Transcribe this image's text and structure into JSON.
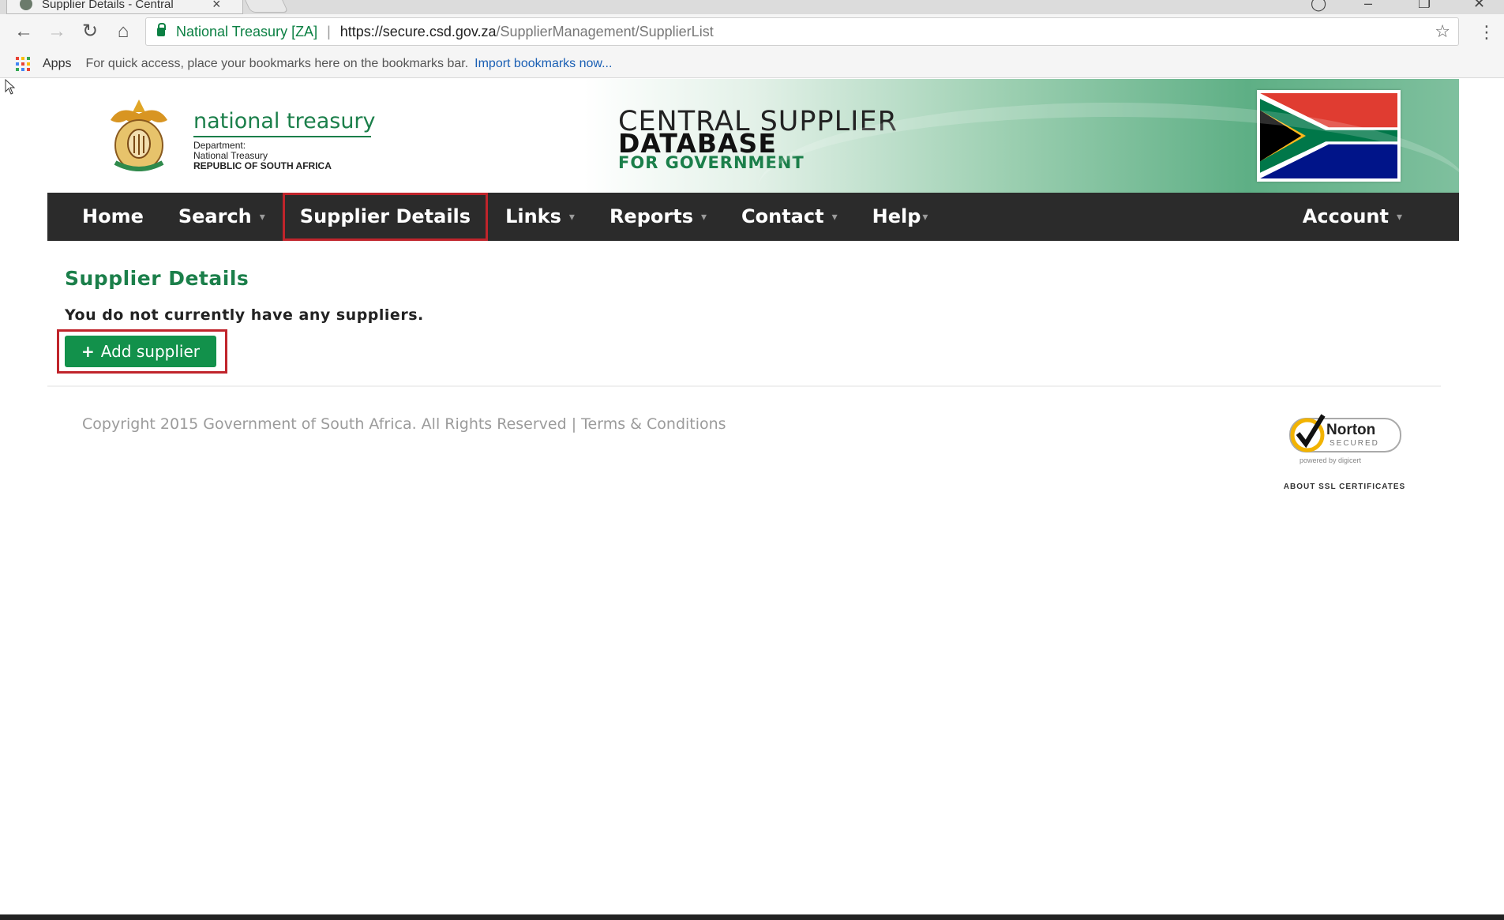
{
  "browser": {
    "tab_title": "Supplier Details - Central",
    "tab_close": "×",
    "secure_label": "National Treasury [ZA]",
    "url_host": "https://secure.csd.gov.za",
    "url_path": "/SupplierManagement/SupplierList",
    "bookmarks": {
      "apps_label": "Apps",
      "hint": "For quick access, place your bookmarks here on the bookmarks bar.",
      "import_link": "Import bookmarks now..."
    }
  },
  "header": {
    "org_name": "national treasury",
    "dept_line1": "Department:",
    "dept_line2": "National Treasury",
    "dept_line3": "REPUBLIC OF SOUTH AFRICA",
    "csd_line1": "CENTRAL SUPPLIER",
    "csd_line2": "DATABASE",
    "csd_line3": "FOR GOVERNMENT"
  },
  "nav": {
    "home": "Home",
    "search": "Search",
    "supplier_details": "Supplier Details",
    "links": "Links",
    "reports": "Reports",
    "contact": "Contact",
    "help": "Help",
    "account": "Account",
    "active_item": "Supplier Details"
  },
  "main": {
    "heading": "Supplier Details",
    "empty_message": "You do not currently have any suppliers.",
    "add_button": "Add supplier"
  },
  "footer": {
    "copyright": "Copyright 2015 Government of South Africa. All Rights Reserved | Terms & Conditions",
    "norton_title": "Norton",
    "norton_sub": "SECURED",
    "norton_powered": "powered by digicert",
    "ssl_link": "ABOUT SSL CERTIFICATES"
  },
  "colors": {
    "brand_green": "#1b7f4a",
    "button_green": "#12914b",
    "nav_bg": "#2b2b2b",
    "highlight_red": "#c0242b"
  }
}
